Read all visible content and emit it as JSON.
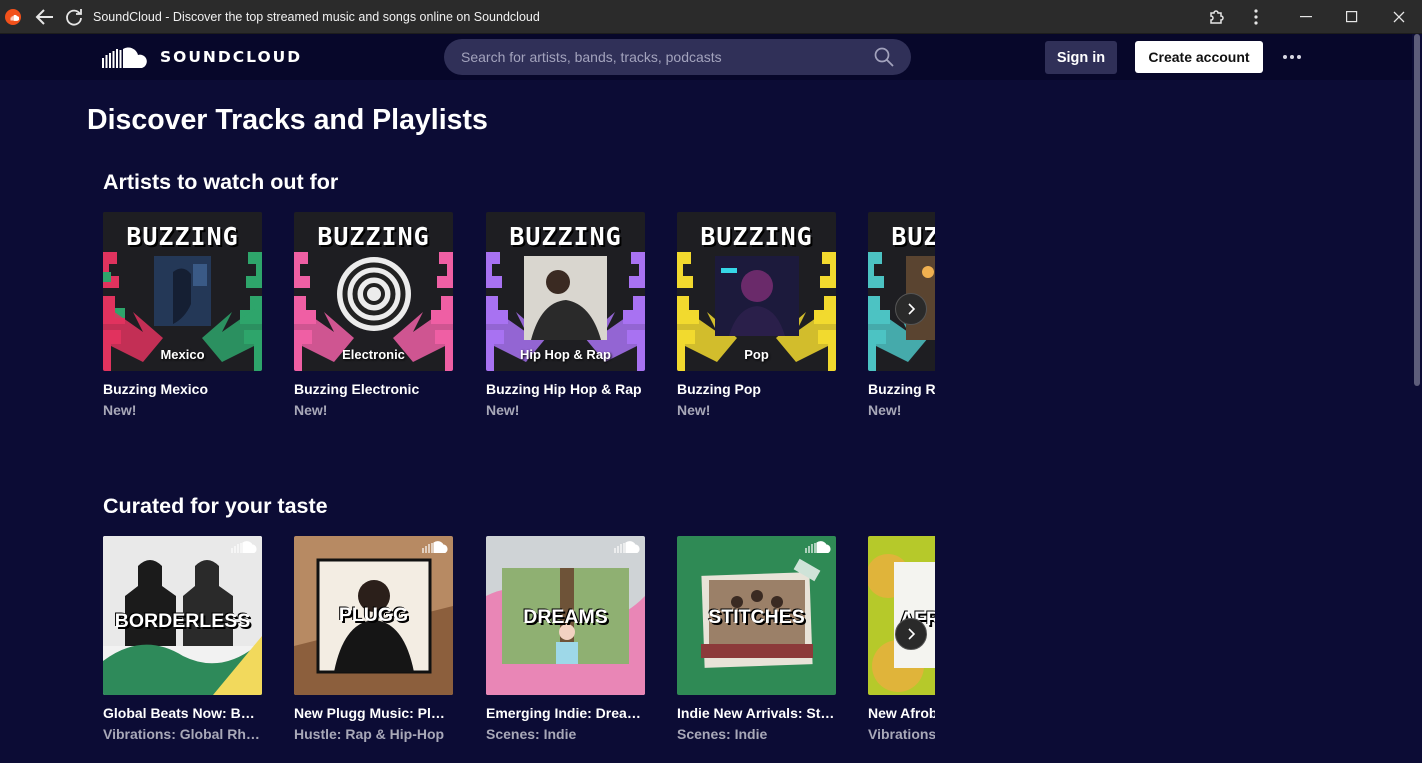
{
  "browser": {
    "title": "SoundCloud - Discover the top streamed music and songs online on Soundcloud"
  },
  "header": {
    "logo_text": "SOUNDCLOUD",
    "search_placeholder": "Search for artists, bands, tracks, podcasts",
    "signin_label": "Sign in",
    "create_label": "Create account"
  },
  "main": {
    "title": "Discover Tracks and Playlists",
    "sections": [
      {
        "title": "Artists to watch out for",
        "cards": [
          {
            "art_word": "BUZZING",
            "art_genre": "Mexico",
            "title": "Buzzing Mexico",
            "subtitle": "New!",
            "accent": "#e0335e"
          },
          {
            "art_word": "BUZZING",
            "art_genre": "Electronic",
            "title": "Buzzing Electronic",
            "subtitle": "New!",
            "accent": "#ef5fa4"
          },
          {
            "art_word": "BUZZING",
            "art_genre": "Hip Hop & Rap",
            "title": "Buzzing Hip Hop & Rap",
            "subtitle": "New!",
            "accent": "#a872f2"
          },
          {
            "art_word": "BUZZING",
            "art_genre": "Pop",
            "title": "Buzzing Pop",
            "subtitle": "New!",
            "accent": "#f2d92e"
          },
          {
            "art_word": "BUZZING",
            "art_genre": "",
            "title": "Buzzing R&B",
            "subtitle": "New!",
            "accent": "#4cc3c3"
          }
        ]
      },
      {
        "title": "Curated for your taste",
        "cards": [
          {
            "art_word": "BORDERLESS",
            "title": "Global Beats Now: Borderless",
            "subtitle": "Vibrations: Global Rhythms",
            "accent": "#2e8a5a"
          },
          {
            "art_word": "PLUGG",
            "title": "New Plugg Music: Plugg",
            "subtitle": "Hustle: Rap & Hip-Hop",
            "accent": "#b07b52"
          },
          {
            "art_word": "DREAMS",
            "title": "Emerging Indie: Dreams",
            "subtitle": "Scenes: Indie",
            "accent": "#e986b6"
          },
          {
            "art_word": "STITCHES",
            "title": "Indie New Arrivals: Stitches",
            "subtitle": "Scenes: Indie",
            "accent": "#2f8a55"
          },
          {
            "art_word": "AFRO",
            "title": "New Afrobeats",
            "subtitle": "Vibrations",
            "accent": "#b6c92a"
          }
        ]
      }
    ]
  },
  "colors": {
    "page_bg": "#0c0c35",
    "header_bg": "#07072a",
    "search_bg": "#303058",
    "brand_orange": "#f2511b"
  },
  "icons": {
    "back": "arrow-left-icon",
    "reload": "reload-icon",
    "extensions": "puzzle-icon",
    "menu": "kebab-icon",
    "search": "search-icon",
    "next": "chevron-right-icon"
  }
}
